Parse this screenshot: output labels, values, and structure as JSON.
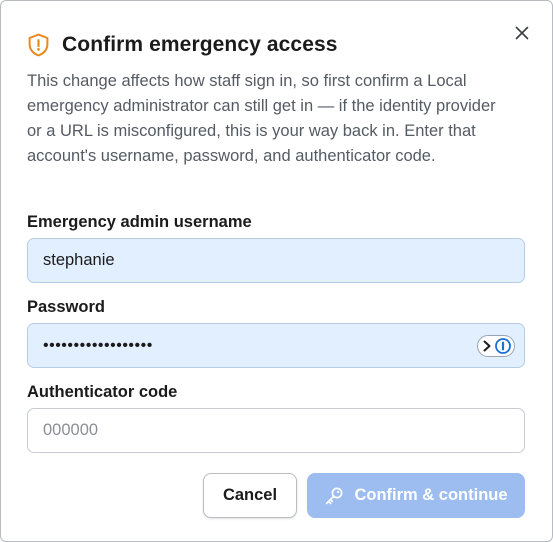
{
  "dialog": {
    "title": "Confirm emergency access",
    "description": "This change affects how staff sign in, so first confirm a Local emergency administrator can still get in — if the identity provider or a URL is misconfigured, this is your way back in. Enter that account's username, password, and authenticator code.",
    "icons": {
      "title": "shield-alert-icon",
      "close": "close-icon",
      "confirm": "key-icon",
      "password_manager": "password-manager-icon"
    },
    "colors": {
      "warning_icon": "#e8891b",
      "filled_field": "#e1efff",
      "confirm_button": "#9dbdf0"
    }
  },
  "fields": {
    "username": {
      "label": "Emergency admin username",
      "value": "stephanie"
    },
    "password": {
      "label": "Password",
      "value": "••••••••••••••••••"
    },
    "code": {
      "label": "Authenticator code",
      "placeholder": "000000"
    }
  },
  "actions": {
    "cancel_label": "Cancel",
    "confirm_label": "Confirm & continue"
  }
}
